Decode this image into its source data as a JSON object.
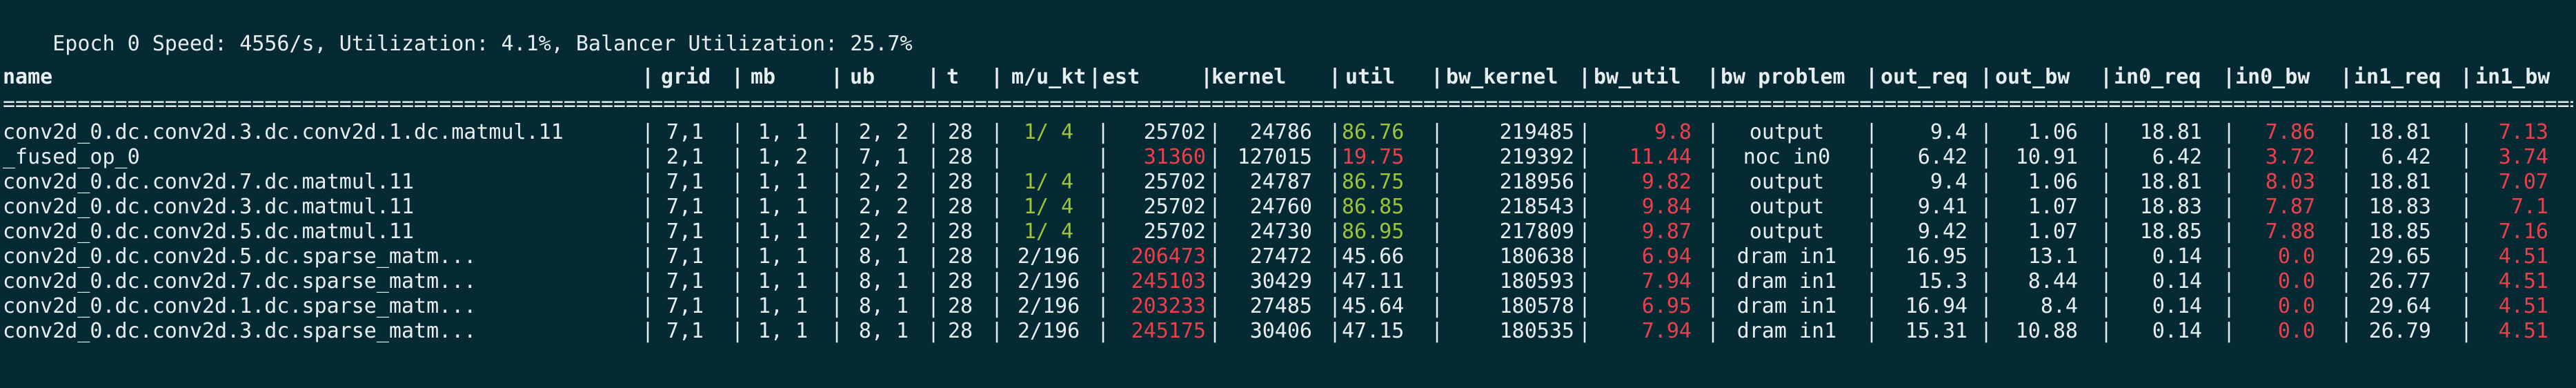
{
  "status": {
    "epoch_label": "Epoch",
    "epoch_value": "0",
    "speed_label": "Speed:",
    "speed_value": "4556/s,",
    "util_label": "Utilization:",
    "util_value": "4.1%,",
    "balancer_label": "Balancer Utilization:",
    "balancer_value": "25.7%"
  },
  "table": {
    "separator": "==============================================================================================================================================================================================================================================================================================================================================",
    "columns": [
      {
        "key": "name",
        "label": "name"
      },
      {
        "key": "grid",
        "label": "grid"
      },
      {
        "key": "mb",
        "label": "mb"
      },
      {
        "key": "ub",
        "label": "ub"
      },
      {
        "key": "t",
        "label": "t"
      },
      {
        "key": "mukt",
        "label": "m/u_kt"
      },
      {
        "key": "est",
        "label": "est"
      },
      {
        "key": "kernel",
        "label": "kernel"
      },
      {
        "key": "util",
        "label": "util"
      },
      {
        "key": "bw_kernel",
        "label": "bw_kernel"
      },
      {
        "key": "bw_util",
        "label": "bw_util"
      },
      {
        "key": "bw_problem",
        "label": "bw problem"
      },
      {
        "key": "out_req",
        "label": "out_req"
      },
      {
        "key": "out_bw",
        "label": "out_bw"
      },
      {
        "key": "in0_req",
        "label": "in0_req"
      },
      {
        "key": "in0_bw",
        "label": "in0_bw"
      },
      {
        "key": "in1_req",
        "label": "in1_req"
      },
      {
        "key": "in1_bw",
        "label": "in1_bw"
      }
    ],
    "rows": [
      {
        "name": "conv2d_0.dc.conv2d.3.dc.conv2d.1.dc.matmul.11",
        "grid": "7,1",
        "mb": "1, 1",
        "ub": "2, 2",
        "t": "28",
        "mukt": "1/ 4",
        "est": "25702",
        "kernel": "24786",
        "util": "86.76",
        "bw_kernel": "219485",
        "bw_util": "9.8",
        "bw_problem": "output",
        "out_req": "9.4",
        "out_bw": "1.06",
        "in0_req": "18.81",
        "in0_bw": "7.86",
        "in1_req": "18.81",
        "in1_bw": "7.13"
      },
      {
        "name": "_fused_op_0",
        "grid": "2,1",
        "mb": "1, 2",
        "ub": "7, 1",
        "t": "28",
        "mukt": "",
        "est": "31360",
        "kernel": "127015",
        "util": "19.75",
        "bw_kernel": "219392",
        "bw_util": "11.44",
        "bw_problem": "noc in0",
        "out_req": "6.42",
        "out_bw": "10.91",
        "in0_req": "6.42",
        "in0_bw": "3.72",
        "in1_req": "6.42",
        "in1_bw": "3.74"
      },
      {
        "name": "conv2d_0.dc.conv2d.7.dc.matmul.11",
        "grid": "7,1",
        "mb": "1, 1",
        "ub": "2, 2",
        "t": "28",
        "mukt": "1/ 4",
        "est": "25702",
        "kernel": "24787",
        "util": "86.75",
        "bw_kernel": "218956",
        "bw_util": "9.82",
        "bw_problem": "output",
        "out_req": "9.4",
        "out_bw": "1.06",
        "in0_req": "18.81",
        "in0_bw": "8.03",
        "in1_req": "18.81",
        "in1_bw": "7.07"
      },
      {
        "name": "conv2d_0.dc.conv2d.3.dc.matmul.11",
        "grid": "7,1",
        "mb": "1, 1",
        "ub": "2, 2",
        "t": "28",
        "mukt": "1/ 4",
        "est": "25702",
        "kernel": "24760",
        "util": "86.85",
        "bw_kernel": "218543",
        "bw_util": "9.84",
        "bw_problem": "output",
        "out_req": "9.41",
        "out_bw": "1.07",
        "in0_req": "18.83",
        "in0_bw": "7.87",
        "in1_req": "18.83",
        "in1_bw": "7.1"
      },
      {
        "name": "conv2d_0.dc.conv2d.5.dc.matmul.11",
        "grid": "7,1",
        "mb": "1, 1",
        "ub": "2, 2",
        "t": "28",
        "mukt": "1/ 4",
        "est": "25702",
        "kernel": "24730",
        "util": "86.95",
        "bw_kernel": "217809",
        "bw_util": "9.87",
        "bw_problem": "output",
        "out_req": "9.42",
        "out_bw": "1.07",
        "in0_req": "18.85",
        "in0_bw": "7.88",
        "in1_req": "18.85",
        "in1_bw": "7.16"
      },
      {
        "name": "conv2d_0.dc.conv2d.5.dc.sparse_matm...",
        "grid": "7,1",
        "mb": "1, 1",
        "ub": "8, 1",
        "t": "28",
        "mukt": "2/196",
        "est": "206473",
        "kernel": "27472",
        "util": "45.66",
        "bw_kernel": "180638",
        "bw_util": "6.94",
        "bw_problem": "dram in1",
        "out_req": "16.95",
        "out_bw": "13.1",
        "in0_req": "0.14",
        "in0_bw": "0.0",
        "in1_req": "29.65",
        "in1_bw": "4.51"
      },
      {
        "name": "conv2d_0.dc.conv2d.7.dc.sparse_matm...",
        "grid": "7,1",
        "mb": "1, 1",
        "ub": "8, 1",
        "t": "28",
        "mukt": "2/196",
        "est": "245103",
        "kernel": "30429",
        "util": "47.11",
        "bw_kernel": "180593",
        "bw_util": "7.94",
        "bw_problem": "dram in1",
        "out_req": "15.3",
        "out_bw": "8.44",
        "in0_req": "0.14",
        "in0_bw": "0.0",
        "in1_req": "26.77",
        "in1_bw": "4.51"
      },
      {
        "name": "conv2d_0.dc.conv2d.1.dc.sparse_matm...",
        "grid": "7,1",
        "mb": "1, 1",
        "ub": "8, 1",
        "t": "28",
        "mukt": "2/196",
        "est": "203233",
        "kernel": "27485",
        "util": "45.64",
        "bw_kernel": "180578",
        "bw_util": "6.95",
        "bw_problem": "dram in1",
        "out_req": "16.94",
        "out_bw": "8.4",
        "in0_req": "0.14",
        "in0_bw": "0.0",
        "in1_req": "29.64",
        "in1_bw": "4.51"
      },
      {
        "name": "conv2d_0.dc.conv2d.3.dc.sparse_matm...",
        "grid": "7,1",
        "mb": "1, 1",
        "ub": "8, 1",
        "t": "28",
        "mukt": "2/196",
        "est": "245175",
        "kernel": "30406",
        "util": "47.15",
        "bw_kernel": "180535",
        "bw_util": "7.94",
        "bw_problem": "dram in1",
        "out_req": "15.31",
        "out_bw": "10.88",
        "in0_req": "0.14",
        "in0_bw": "0.0",
        "in1_req": "26.79",
        "in1_bw": "4.51"
      }
    ],
    "colors": {
      "background": "#062a33",
      "text": "#e6eef0",
      "green": "#9cc33a",
      "red": "#e8414d"
    },
    "highlights": [
      {
        "mukt": "green",
        "util": "green",
        "bw_util": "red",
        "in0_bw": "red",
        "in1_bw": "red"
      },
      {
        "est": "red",
        "util": "red",
        "bw_util": "red",
        "in0_bw": "red",
        "in1_bw": "red"
      },
      {
        "mukt": "green",
        "util": "green",
        "bw_util": "red",
        "in0_bw": "red",
        "in1_bw": "red"
      },
      {
        "mukt": "green",
        "util": "green",
        "bw_util": "red",
        "in0_bw": "red",
        "in1_bw": "red"
      },
      {
        "mukt": "green",
        "util": "green",
        "bw_util": "red",
        "in0_bw": "red",
        "in1_bw": "red"
      },
      {
        "est": "red",
        "bw_util": "red",
        "in0_bw": "red",
        "in1_bw": "red"
      },
      {
        "est": "red",
        "bw_util": "red",
        "in0_bw": "red",
        "in1_bw": "red"
      },
      {
        "est": "red",
        "bw_util": "red",
        "in0_bw": "red",
        "in1_bw": "red"
      },
      {
        "est": "red",
        "bw_util": "red",
        "in0_bw": "red",
        "in1_bw": "red"
      }
    ]
  }
}
